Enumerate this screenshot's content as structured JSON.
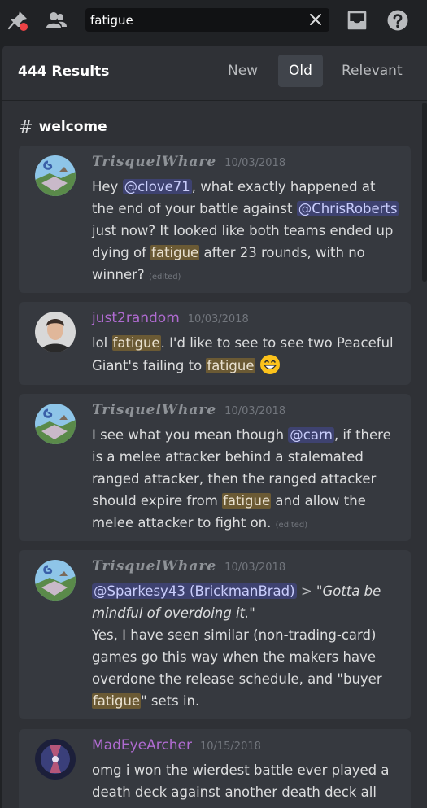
{
  "search": {
    "query": "fatigue"
  },
  "results": {
    "count_label": "444 Results",
    "tabs": [
      {
        "label": "New",
        "active": false
      },
      {
        "label": "Old",
        "active": true
      },
      {
        "label": "Relevant",
        "active": false
      }
    ]
  },
  "channel": {
    "hash": "#",
    "name": "welcome"
  },
  "messages": [
    {
      "author": "TrisquelWhare",
      "timestamp": "10/03/2018",
      "segments": {
        "s1": "Hey ",
        "m1": "@clove71",
        "s2": ", what exactly happened at the end of your battle against ",
        "m2": "@ChrisRoberts",
        "s3": " just now? It looked like both teams ended up dying of ",
        "h1": "fatigue",
        "s4": " after 23 rounds, with no winner? ",
        "edited": "(edited)"
      }
    },
    {
      "author": "just2random",
      "timestamp": "10/03/2018",
      "segments": {
        "s1": "lol ",
        "h1": "fatigue",
        "s2": ". I'd like to see to see two Peaceful Giant's failing to ",
        "h2": "fatigue",
        "s3": " "
      }
    },
    {
      "author": "TrisquelWhare",
      "timestamp": "10/03/2018",
      "segments": {
        "s1": "I see what you mean though ",
        "m1": "@carn",
        "s2": ", if there is a melee attacker behind a stalemated ranged attacker, then the ranged attacker should expire from ",
        "h1": "fatigue",
        "s3": " and allow the melee attacker to fight on. ",
        "edited": "(edited)"
      }
    },
    {
      "author": "TrisquelWhare",
      "timestamp": "10/03/2018",
      "segments": {
        "m1": "@Sparkesy43 (BrickmanBrad)",
        "s1": " > ",
        "q1": "\"Gotta be mindful of overdoing it.\"",
        "s2": "Yes, I have seen similar (non-trading-card) games go this way when the makers have overdone the release schedule, and \"buyer ",
        "h1": "fatigue",
        "s3": "\" sets in."
      }
    },
    {
      "author": "MadEyeArcher",
      "timestamp": "10/15/2018",
      "segments": {
        "s1": "omg i won the wierdest battle ever played a death deck against another death deck all"
      }
    }
  ],
  "colors": {
    "background": "#202225",
    "panel": "#2f3136",
    "card": "#36393f",
    "mention_bg": "#3e4270",
    "highlight_bg": "#6b5a34",
    "author_purple": "#b06bd1"
  },
  "icons": [
    "pin-icon",
    "members-icon",
    "clear-icon",
    "inbox-icon",
    "help-icon",
    "grinning-emoji-icon"
  ]
}
